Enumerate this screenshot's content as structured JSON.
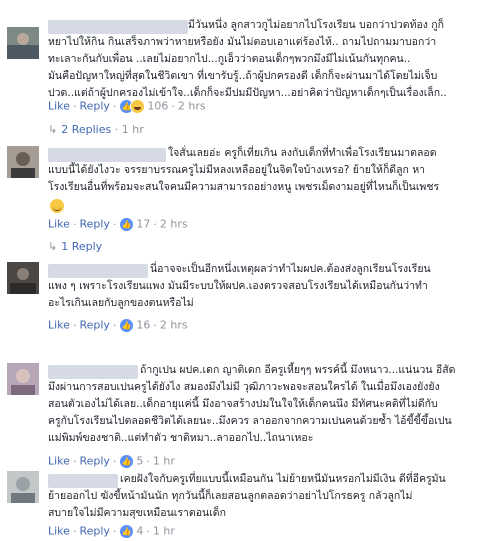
{
  "comments": [
    {
      "text": "มีวันหนึ่ง ลูกสาวกูไม่อยากไปโรงเรียน บอกว่าปวดท้อง กูก็\nหยาไปให้กิน กินเสร็จภาพว่าหายหรือยัง มันไม่ตอบเอาแต่ร้องไห้.. ถามไปถามมาบอกว่า\nทะเลาะกันกับเพื่อน ..เลยไม่อยากไป...กูเอ็วว่าตอนเด็กๆพวกมึงมีไม่เน้นกันทุกคน..\nมันคือปัญหาใหญ่ที่สุดในชีวิตเขา ที่เขารับรู้..ถ้าผู้ปกครองดี เด็กก็จะผ่านมาได้โดยไม่เจ็บ\nปวด..แต่ถ้าผู้ปกครองไม่เข้าใจ..เด็กก็จะมีปมมีปัญหา...อย่าคิดว่าปัญหาเด็กๆเป็นเรื่องเล็ก..",
      "like": "Like",
      "reply": "Reply",
      "reaction_count": "106",
      "time": "2 hrs",
      "replies_label": "2 Replies",
      "replies_time": "1 hr"
    },
    {
      "text": "ใจสั่นเลยอ่ะ ครูก็เที่ยเกิน ลงกับเด็กที่ทำเพื่อโรงเรียนมาตลอด\nแบบนี้ได้ยังไงวะ จรรยาบรรณครูไม่มีหลงเหลืออยู่ในจิตใจบ้างเหรอ? ย้ายให้ก็ดีลูก หา\nโรงเรียนอื่นที่พร้อมจะสนใจคนมีความสามารถอย่างหนู เพชรเม็ดงามอยู่ที่ไหนก็เป็นเพชร",
      "like": "Like",
      "reply": "Reply",
      "reaction_count": "17",
      "time": "2 hrs",
      "replies_label": "1 Reply",
      "replies_time": ""
    },
    {
      "text": "นี่อาจจะเป็นอีกหนึ่งเหตุผลว่าทำไมผปค.ต้องส่งลูกเรียนโรงเรียน\nแพง ๆ เพราะโรงเรียนแพง มันมีระบบให้ผปค.เองตรวจสอบโรงเรียนได้เหมือนกันว่าทำ\nอะไรเกินเลยกับลูกของตนหรือไม่",
      "like": "Like",
      "reply": "Reply",
      "reaction_count": "16",
      "time": "2 hrs",
      "replies_label": "",
      "replies_time": ""
    },
    {
      "text": "ถ้ากูเปน ผปค.เดก ญาติเดก อีครูเหี้ยๆๆ พรรค์นี้ มึงหนาว...แน่นวน อีสัด\nมึงผ่านการสอบเปนครูได้ยังไง สมองมึงไม่มี วุฒิภาวะพอจะสอนใครได้ ในเมื่อมึงเองยังยัง\nสอนตัวเองไม่ได้เลย..เด็กอายุแค่นี้ มึงอาจสร้างปมในใจให้เด็กคนนึง มีทัศนะคติที่ไม่ดีกับ\nครูกับโรงเรียนไปตลอดชีวิตได้เลยนะ..มึงควร ลาออกจากความเปนคนด้วยซ้ำ ไอ้ขี้ขี้ขึ้อเปน\nแม่พิมพ์ของชาติ..แต่ทำตัว ชาติหมา..ลาออกไป..ไถนาเหอะ",
      "like": "Like",
      "reply": "Reply",
      "reaction_count": "5",
      "time": "1 hr",
      "replies_label": "",
      "replies_time": ""
    },
    {
      "text": "เคยฝังใจกับครูเที่ยแบบนี้เหมือนกัน ไม่ย้ายหนีมันหรอกไม่มีเงิน ดีที่อีครูมัน\nย้ายออกไป ฆังขี้หน้ามันนัก ทุกวันนี้ก็เลยสอนลูกตลอดว่าอย่าไปโกรธครู กลัวลูกไม่\nสบายใจไม่มีความสุขเหมือนเราตอนเด็ก",
      "like": "Like",
      "reply": "Reply",
      "reaction_count": "4",
      "time": "1 hr",
      "replies_label": "",
      "replies_time": ""
    }
  ]
}
